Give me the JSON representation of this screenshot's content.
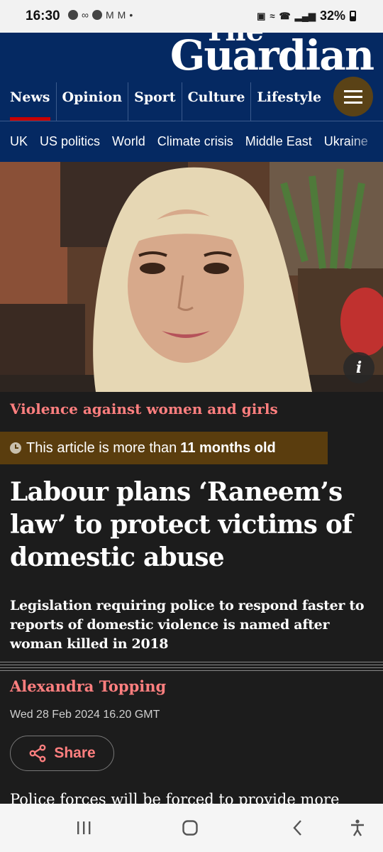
{
  "status_bar": {
    "time": "16:30",
    "battery": "32%"
  },
  "header": {
    "logo_top": "The",
    "logo": "Guardian",
    "pillars": [
      "News",
      "Opinion",
      "Sport",
      "Culture",
      "Lifestyle"
    ],
    "active_pillar": "News",
    "accent_color": "#c70000",
    "brand_color": "#052962"
  },
  "subnav": {
    "items": [
      "UK",
      "US politics",
      "World",
      "Climate crisis",
      "Middle East",
      "Ukraine"
    ]
  },
  "hero": {
    "info_label": "i"
  },
  "article": {
    "kicker": "Violence against women and girls",
    "age_warning_prefix": "This article is more than",
    "age_warning_value": "11 months old",
    "headline": "Labour plans ‘Raneem’s law’ to protect victims of domestic abuse",
    "standfirst": "Legislation requiring police to respond faster to reports of domestic violence is named after woman killed in 2018",
    "byline": "Alexandra Topping",
    "dateline": "Wed 28 Feb 2024 16.20 GMT",
    "share_label": "Share",
    "body_start": "Police forces will be forced to provide more"
  }
}
